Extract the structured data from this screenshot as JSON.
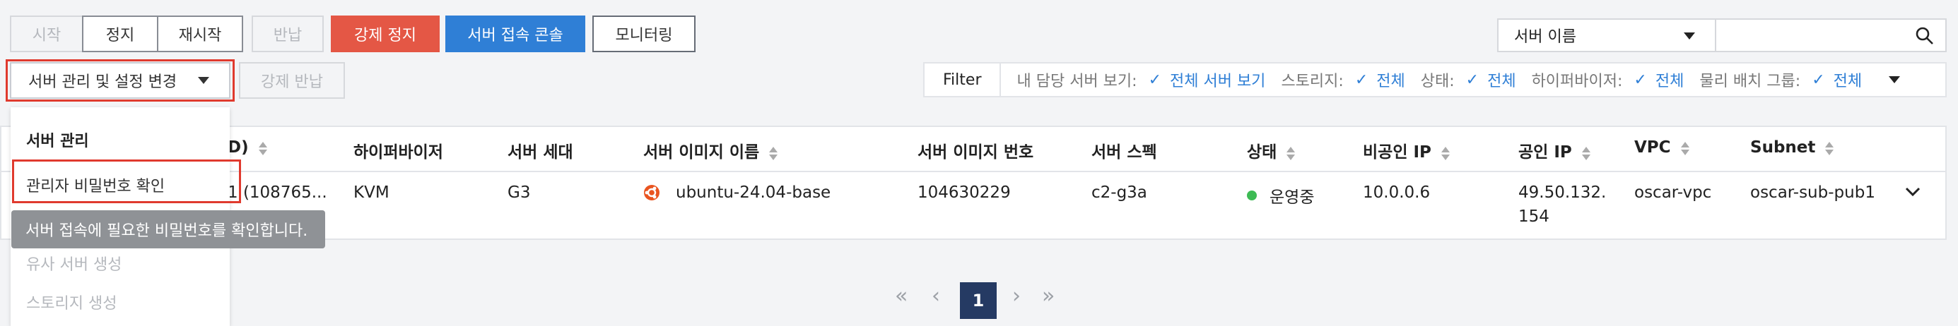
{
  "toolbar": {
    "start": "시작",
    "stop": "정지",
    "restart": "재시작",
    "return": "반납",
    "force_stop": "강제 정지",
    "console": "서버 접속 콘솔",
    "monitoring": "모니터링",
    "manage": "서버 관리 및 설정 변경",
    "force_return": "강제 반납"
  },
  "search": {
    "select_value": "서버 이름",
    "input_value": ""
  },
  "filter": {
    "label": "Filter",
    "items": [
      {
        "key": "내 담당 서버 보기:",
        "value": "전체 서버 보기"
      },
      {
        "key": "스토리지:",
        "value": "전체"
      },
      {
        "key": "상태:",
        "value": "전체"
      },
      {
        "key": "하이퍼바이저:",
        "value": "전체"
      },
      {
        "key": "물리 배치 그룹:",
        "value": "전체"
      }
    ]
  },
  "table": {
    "headers": {
      "id": "D)",
      "hypervisor": "하이퍼바이저",
      "generation": "서버 세대",
      "image_name": "서버 이미지 이름",
      "image_no": "서버 이미지 번호",
      "spec": "서버 스펙",
      "status": "상태",
      "private_ip": "비공인 IP",
      "public_ip": "공인 IP",
      "vpc": "VPC",
      "subnet": "Subnet"
    },
    "rows": [
      {
        "id": "1 (108765...",
        "hypervisor": "KVM",
        "generation": "G3",
        "image_name": "ubuntu-24.04-base",
        "image_no": "104630229",
        "spec": "c2-g3a",
        "status": "운영중",
        "private_ip": "10.0.0.6",
        "public_ip_line1": "49.50.132.",
        "public_ip_line2": "154",
        "vpc": "oscar-vpc",
        "subnet": "oscar-sub-pub1"
      }
    ]
  },
  "dropdown": {
    "section": "서버 관리",
    "items": [
      "관리자 비밀번호 확인",
      "유사 서버 생성",
      "스토리지 생성"
    ]
  },
  "tooltip": "서버 접속에 필요한 비밀번호를 확인합니다.",
  "pagination": {
    "current": "1"
  },
  "colors": {
    "red": "#e45745",
    "blue": "#2f7fd6",
    "status_green": "#3dbb54",
    "page_active": "#253a63"
  }
}
